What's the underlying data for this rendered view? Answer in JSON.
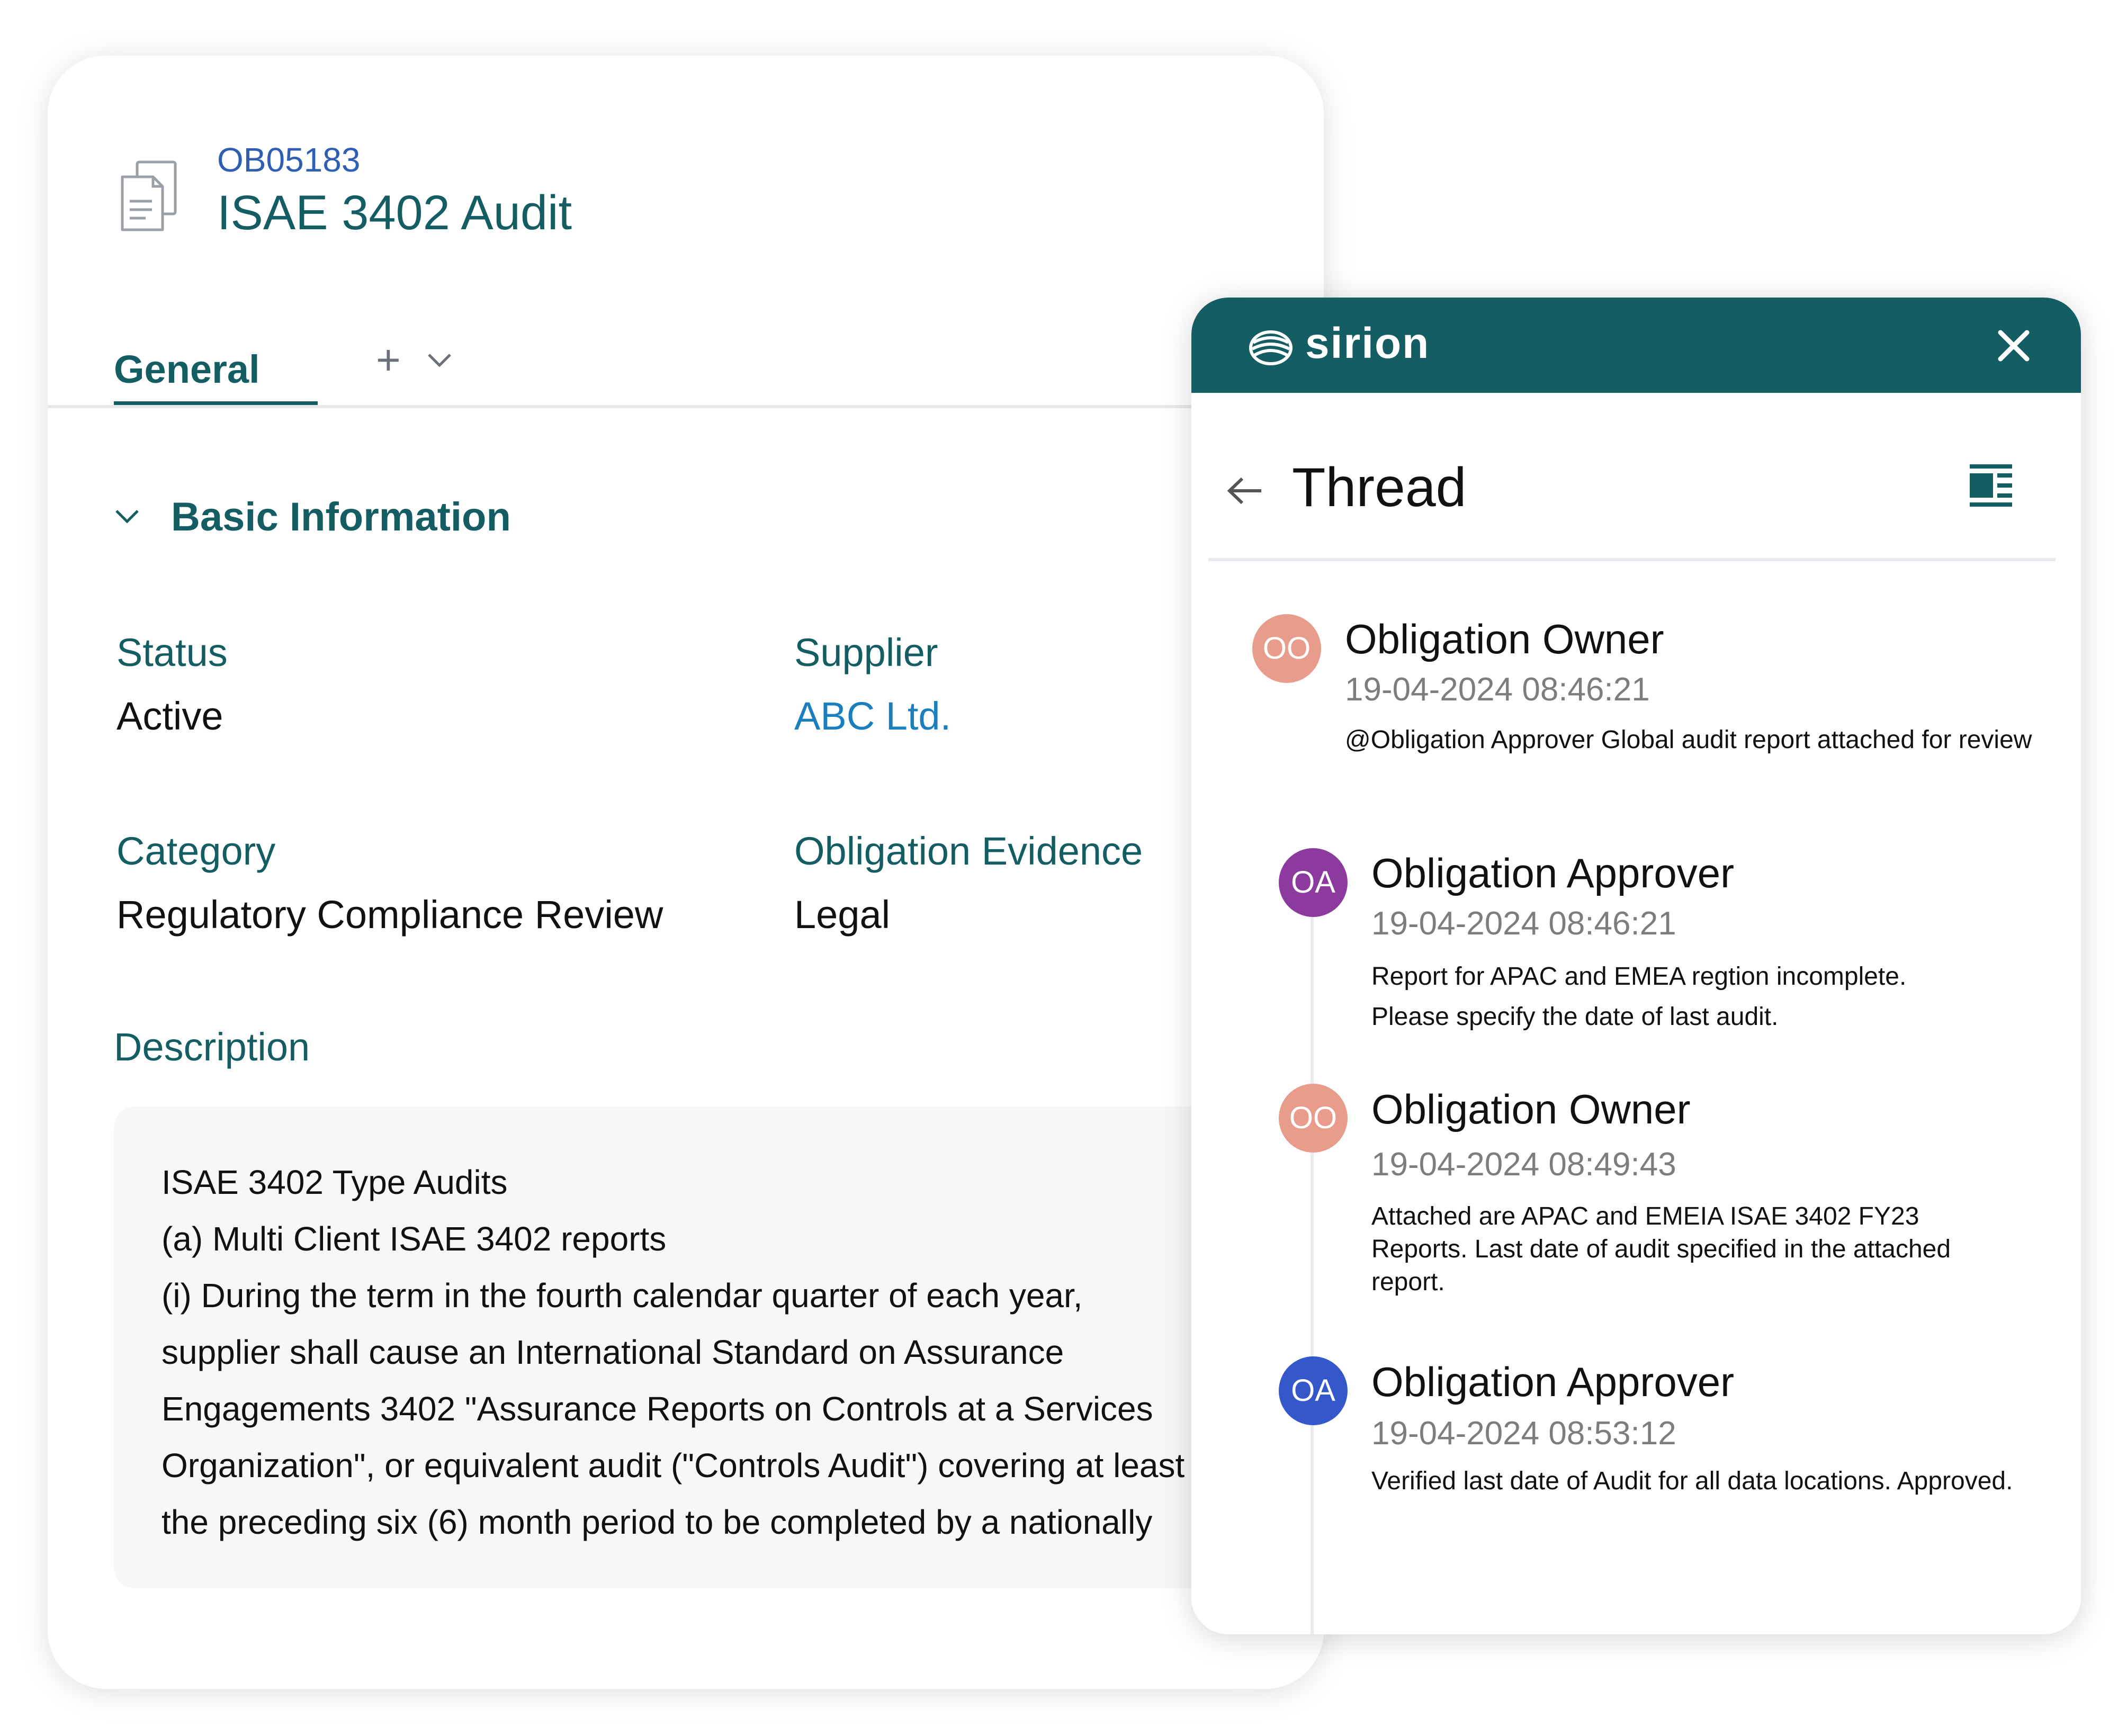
{
  "record": {
    "id": "OB05183",
    "title": "ISAE 3402 Audit"
  },
  "tabs": {
    "general_label": "General",
    "add_icon": "plus-icon",
    "more_icon": "chevron-down-icon"
  },
  "section": {
    "title": "Basic Information",
    "fields": {
      "status_label": "Status",
      "status_value": "Active",
      "supplier_label": "Supplier",
      "supplier_value": "ABC Ltd.",
      "category_label": "Category",
      "category_value": "Regulatory Compliance Review",
      "evidence_label": "Obligation Evidence",
      "evidence_value": "Legal"
    },
    "description_label": "Description",
    "description_lines": [
      "ISAE 3402 Type Audits",
      "(a) Multi Client ISAE 3402 reports",
      "(i)  During the term in the fourth calendar quarter of each year,",
      "supplier shall cause an International Standard on Assurance",
      "Engagements 3402 \"Assurance Reports on Controls at a Services",
      "Organization\", or equivalent audit (\"Controls Audit\") covering at least",
      "the preceding six (6) month period to be completed by a nationally"
    ]
  },
  "panel": {
    "brand": "sirion",
    "title": "Thread",
    "header_color": "#135d63",
    "messages": [
      {
        "initials": "OO",
        "author": "Obligation Owner",
        "timestamp": "19-04-2024 08:46:21",
        "lines": [
          "@Obligation Approver Global audit report attached for review"
        ],
        "avatar_color": "#e89c8c"
      },
      {
        "initials": "OA",
        "author": "Obligation Approver",
        "timestamp": "19-04-2024 08:46:21",
        "lines": [
          "Report for APAC and EMEA regtion incomplete.",
          "Please specify the date of last audit."
        ],
        "avatar_color": "#8d3a9e"
      },
      {
        "initials": "OO",
        "author": "Obligation Owner",
        "timestamp": "19-04-2024 08:49:43",
        "lines": [
          "Attached are APAC and EMEIA ISAE 3402 FY23",
          "Reports. Last date of audit specified in the attached",
          "report."
        ],
        "avatar_color": "#e89c8c"
      },
      {
        "initials": "OA",
        "author": "Obligation Approver",
        "timestamp": "19-04-2024 08:53:12",
        "lines": [
          "Verified last date of Audit for all data locations. Approved."
        ],
        "avatar_color": "#3457c9"
      }
    ]
  }
}
